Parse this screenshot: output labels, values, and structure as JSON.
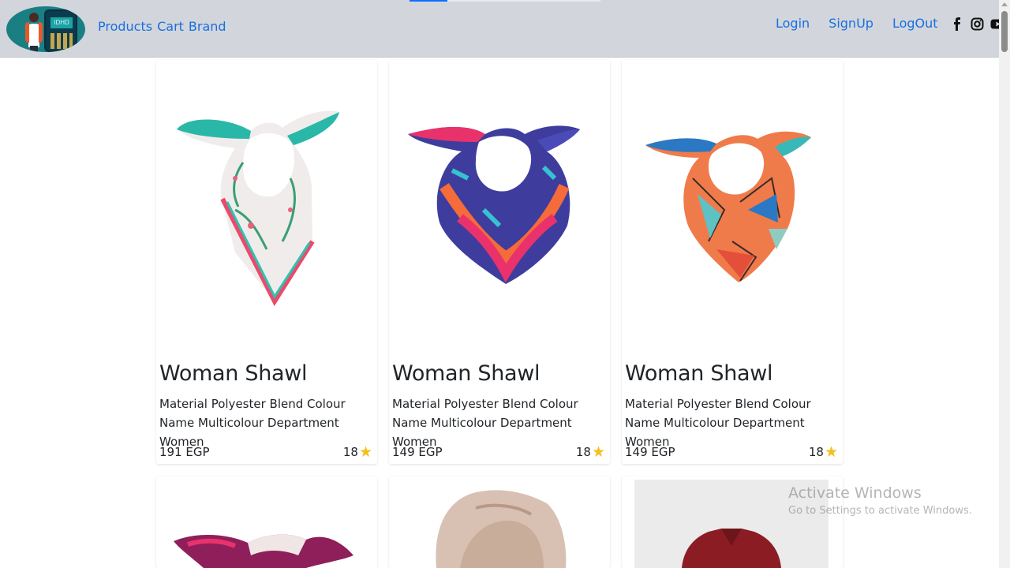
{
  "navbar": {
    "logo_screen_text": "IDHD",
    "links_left": [
      "Products",
      "Cart",
      "Brand"
    ],
    "links_right": [
      "Login",
      "SignUp",
      "LogOut"
    ],
    "social": [
      "facebook-icon",
      "instagram-icon",
      "youtube-icon"
    ],
    "link_color": "#1a6fe0",
    "bg_color": "#d2d6dc"
  },
  "products": [
    {
      "title": "Woman Shawl",
      "description": "Material Polyester Blend Colour Name Multicolour Department Women",
      "price": "191 EGP",
      "rating": "18"
    },
    {
      "title": "Woman Shawl",
      "description": "Material Polyester Blend Colour Name Multicolour Department Women",
      "price": "149 EGP",
      "rating": "18"
    },
    {
      "title": "Woman Shawl",
      "description": "Material Polyester Blend Colour Name Multicolour Department Women",
      "price": "149 EGP",
      "rating": "18"
    }
  ],
  "watermark": {
    "title": "Activate Windows",
    "subtitle": "Go to Settings to activate Windows."
  },
  "colors": {
    "star": "#f3c01c"
  }
}
